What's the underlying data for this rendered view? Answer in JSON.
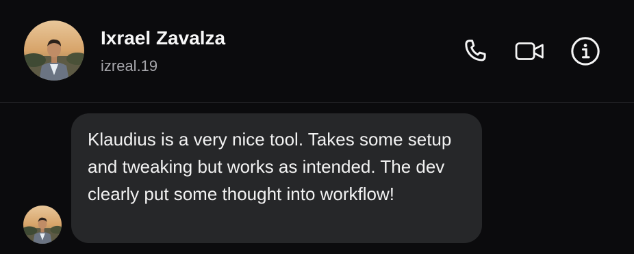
{
  "contact": {
    "name": "Ixrael Zavalza",
    "handle": "izreal.19"
  },
  "actions": {
    "call_icon": "phone-icon",
    "video_icon": "video-camera-icon",
    "info_icon": "info-icon"
  },
  "messages": [
    {
      "text": "Klaudius is a very nice tool. Takes some setup and tweaking but works as intended. The dev clearly put some thought into workflow!"
    }
  ],
  "colors": {
    "background": "#0b0b0d",
    "bubble": "#262729",
    "divider": "#2a2a2e",
    "secondary_text": "#a7a7ac"
  }
}
